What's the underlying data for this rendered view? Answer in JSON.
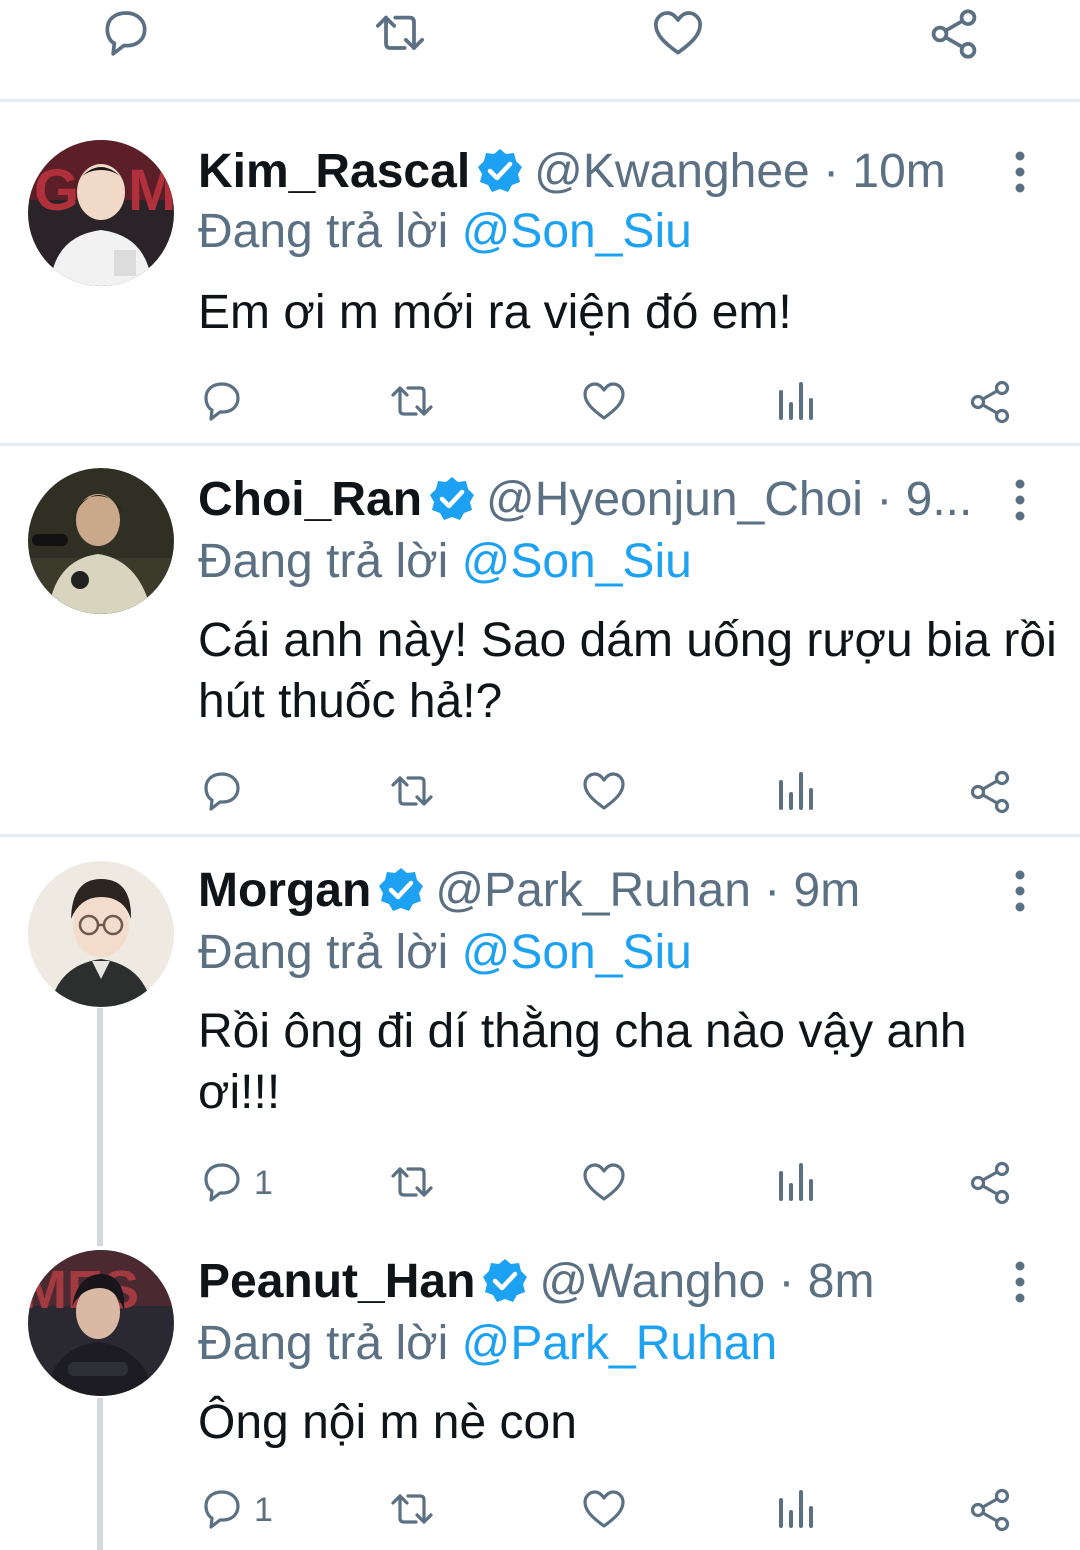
{
  "top_actions": {
    "icons": [
      "reply-icon",
      "retweet-icon",
      "like-icon",
      "share-icon"
    ]
  },
  "colors": {
    "text": "#0f1419",
    "secondary": "#5b7083",
    "accent": "#1da1f2",
    "divider": "#e6ecf0"
  },
  "tweets": [
    {
      "display_name": "Kim_Rascal",
      "verified": true,
      "handle": "@Kwanghee",
      "time": "· 10m",
      "reply_prefix": "Đang trả lời",
      "reply_to": "@Son_Siu",
      "text": "Em ơi m mới ra viện đó em!",
      "reply_count": ""
    },
    {
      "display_name": "Choi_Ran",
      "verified": true,
      "handle": "@Hyeonjun_Choi",
      "time": "· 9...",
      "reply_prefix": "Đang trả lời",
      "reply_to": "@Son_Siu",
      "text": "Cái anh này! Sao dám uống rượu bia rồi hút thuốc hả!?",
      "reply_count": ""
    },
    {
      "display_name": "Morgan",
      "verified": true,
      "handle": "@Park_Ruhan",
      "time": "· 9m",
      "reply_prefix": "Đang trả lời",
      "reply_to": "@Son_Siu",
      "text": "Rồi ông đi dí thằng cha nào vậy anh ơi!!!",
      "reply_count": "1"
    },
    {
      "display_name": "Peanut_Han",
      "verified": true,
      "handle": "@Wangho",
      "time": "· 8m",
      "reply_prefix": "Đang trả lời",
      "reply_to": "@Park_Ruhan",
      "text": "Ông nội m nè con",
      "reply_count": "1"
    }
  ]
}
